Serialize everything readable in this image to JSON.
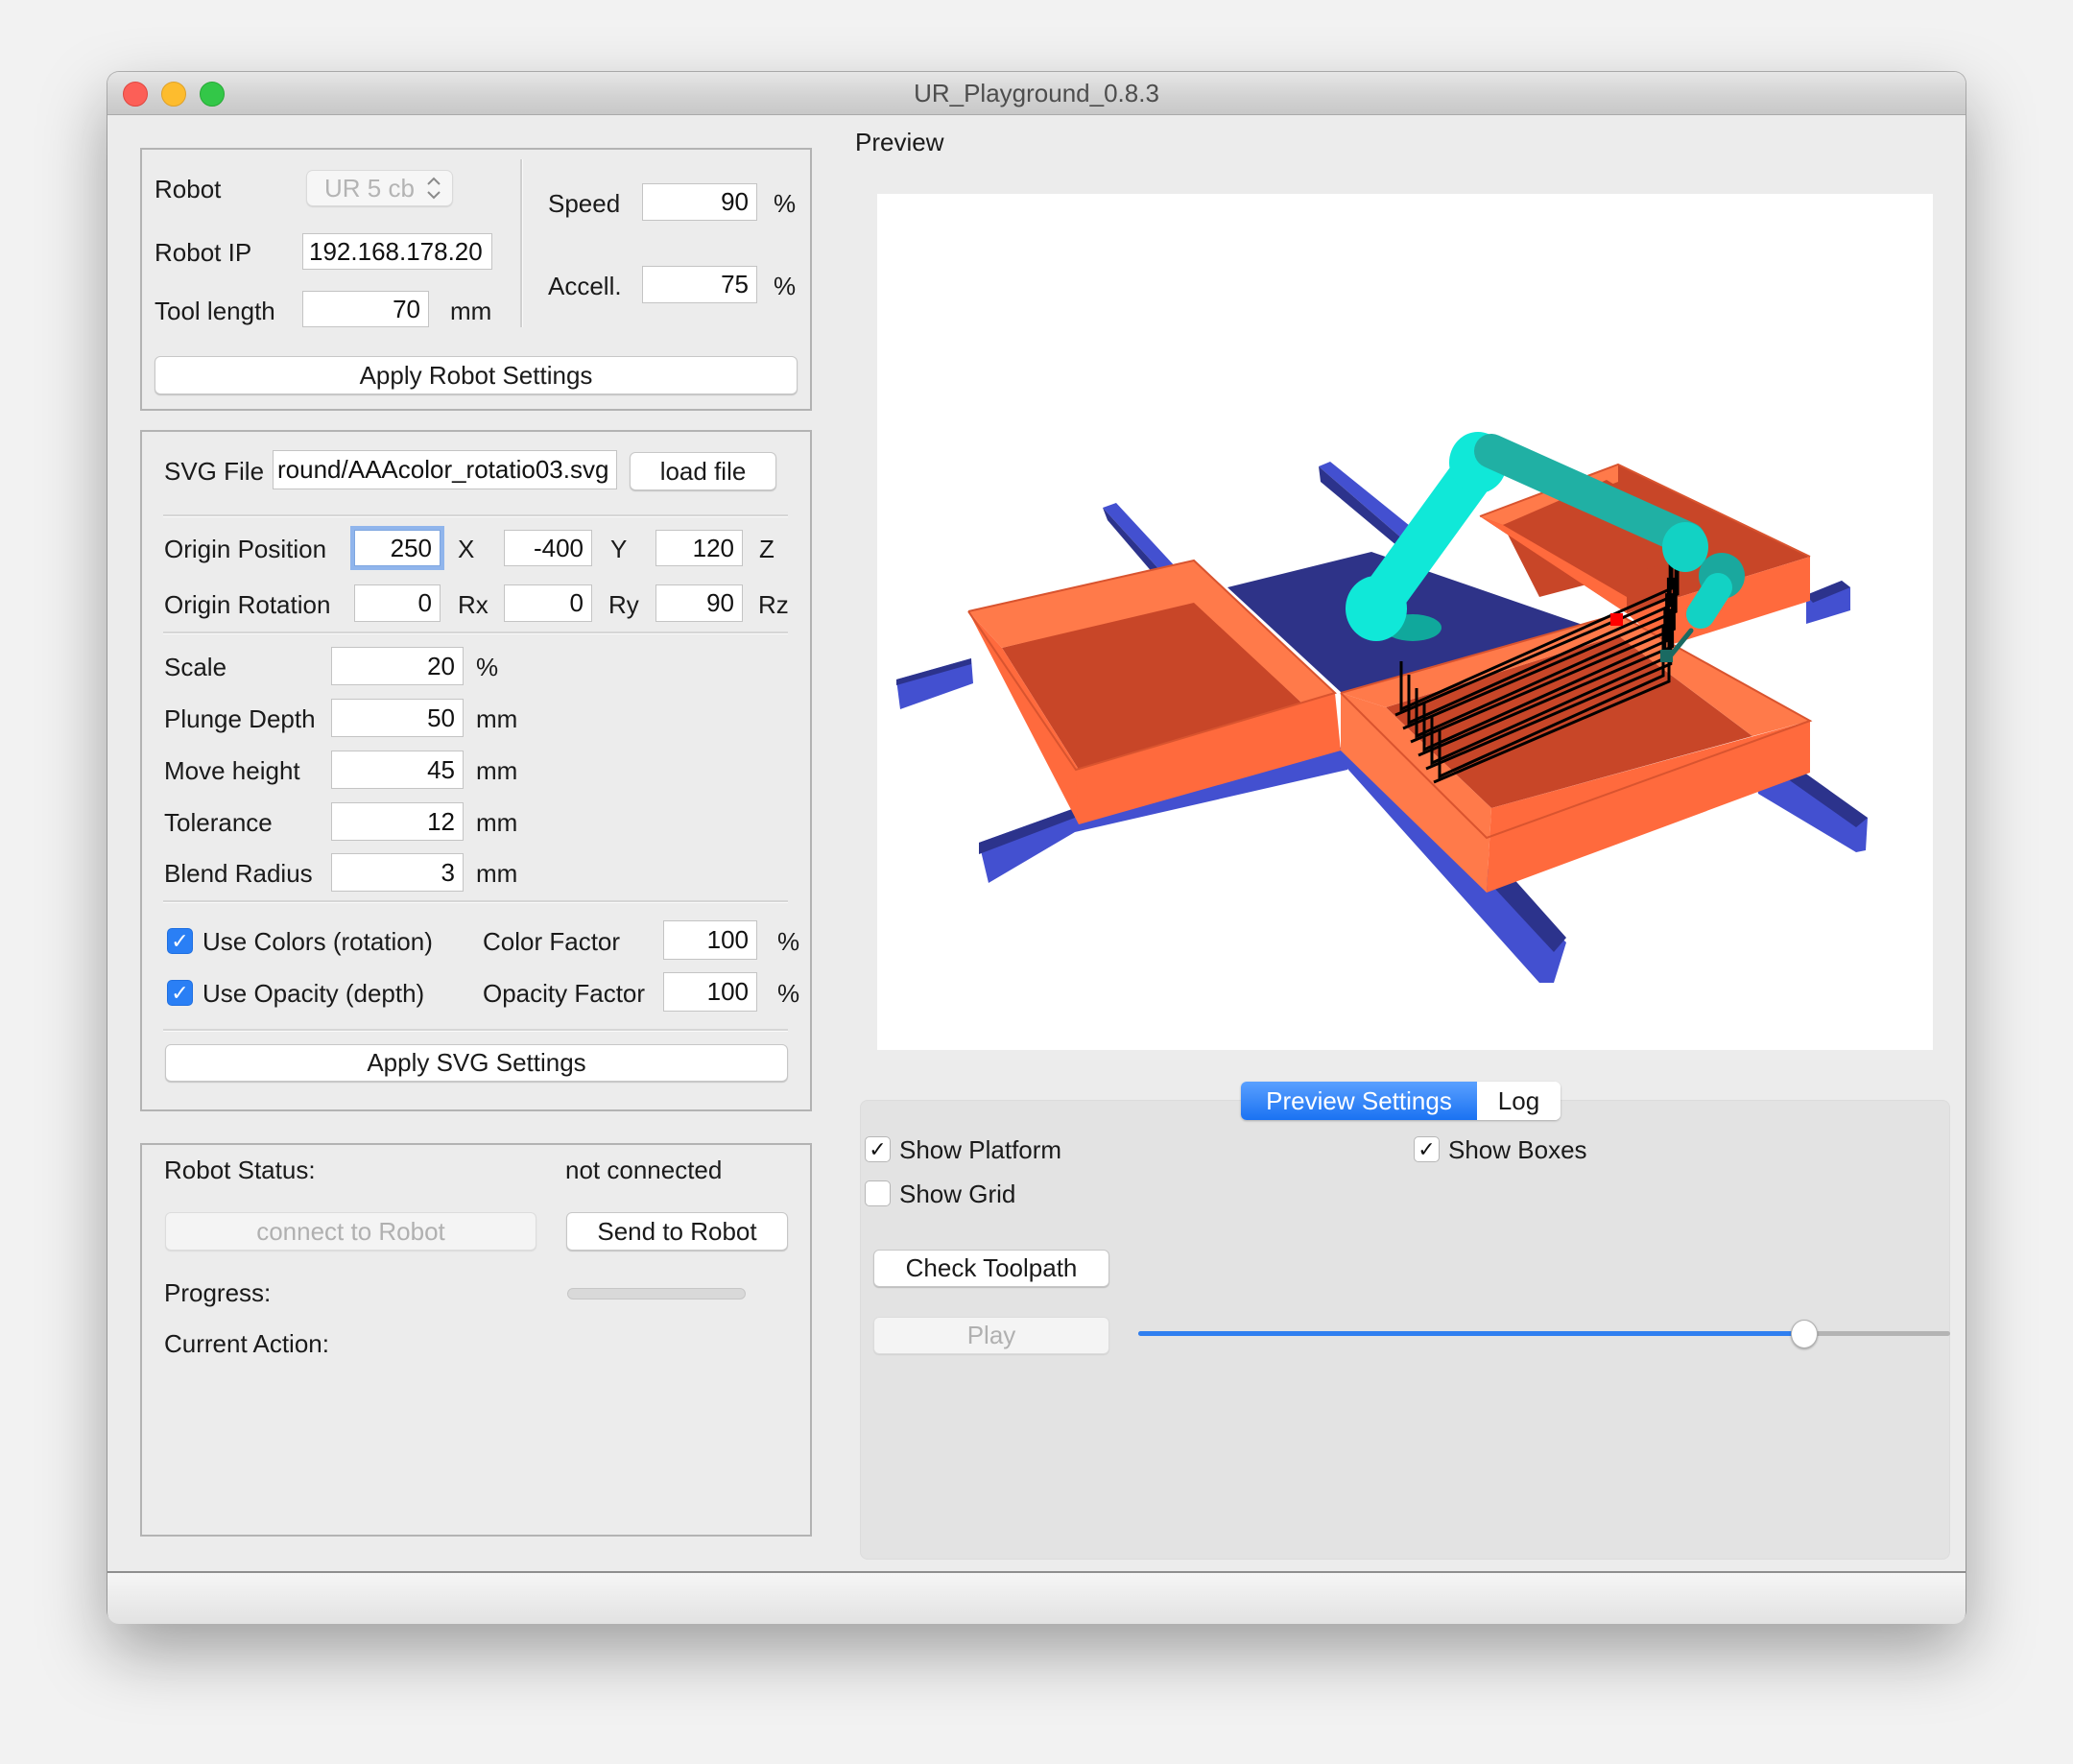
{
  "window": {
    "title": "UR_Playground_0.8.3"
  },
  "robot_settings": {
    "robot_label": "Robot",
    "robot_model": "UR 5 cb",
    "robot_ip_label": "Robot IP",
    "robot_ip": "192.168.178.20",
    "tool_length_label": "Tool length",
    "tool_length": "70",
    "tool_length_unit": "mm",
    "speed_label": "Speed",
    "speed": "90",
    "speed_unit": "%",
    "accel_label": "Accell.",
    "accel": "75",
    "accel_unit": "%",
    "apply_label": "Apply Robot Settings"
  },
  "svg_settings": {
    "svg_file_label": "SVG File",
    "svg_file": "round/AAAcolor_rotatio03.svg",
    "load_file_label": "load file",
    "origin_position_label": "Origin Position",
    "origin_position": {
      "x": "250",
      "y": "-400",
      "z": "120"
    },
    "axis_labels": {
      "x": "X",
      "y": "Y",
      "z": "Z",
      "rx": "Rx",
      "ry": "Ry",
      "rz": "Rz"
    },
    "origin_rotation_label": "Origin Rotation",
    "origin_rotation": {
      "rx": "0",
      "ry": "0",
      "rz": "90"
    },
    "params": [
      {
        "label": "Scale",
        "value": "20",
        "unit": "%"
      },
      {
        "label": "Plunge Depth",
        "value": "50",
        "unit": "mm"
      },
      {
        "label": "Move height",
        "value": "45",
        "unit": "mm"
      },
      {
        "label": "Tolerance",
        "value": "12",
        "unit": "mm"
      },
      {
        "label": "Blend Radius",
        "value": "3",
        "unit": "mm"
      }
    ],
    "use_colors_label": "Use Colors (rotation)",
    "use_colors_checked": true,
    "color_factor_label": "Color Factor",
    "color_factor": "100",
    "color_factor_unit": "%",
    "use_opacity_label": "Use Opacity (depth)",
    "use_opacity_checked": true,
    "opacity_factor_label": "Opacity Factor",
    "opacity_factor": "100",
    "opacity_factor_unit": "%",
    "apply_label": "Apply SVG Settings"
  },
  "robot_status": {
    "status_label": "Robot Status:",
    "status_value": "not connected",
    "connect_label": "connect to Robot",
    "send_label": "Send to Robot",
    "progress_label": "Progress:",
    "progress_value": 0,
    "current_action_label": "Current Action:",
    "current_action_value": ""
  },
  "preview": {
    "label": "Preview",
    "scene": {
      "platform_color": "#2e3388",
      "rail_color": "#4350d0",
      "box_color": "#ff6a3d",
      "box_inner_color": "#c84628",
      "robot_color": "#10e8d8",
      "toolpath_color": "#000000",
      "marker_color": "#ff0000"
    }
  },
  "tabs": [
    {
      "label": "Preview Settings",
      "active": true
    },
    {
      "label": "Log",
      "active": false
    }
  ],
  "preview_settings": {
    "show_platform_label": "Show Platform",
    "show_platform": true,
    "show_boxes_label": "Show Boxes",
    "show_boxes": true,
    "show_grid_label": "Show Grid",
    "show_grid": false,
    "check_toolpath_label": "Check Toolpath",
    "play_label": "Play",
    "playback_position": 0.82
  },
  "colors": {
    "accent": "#2a7ff5",
    "focus_ring": "#90b5ec"
  }
}
